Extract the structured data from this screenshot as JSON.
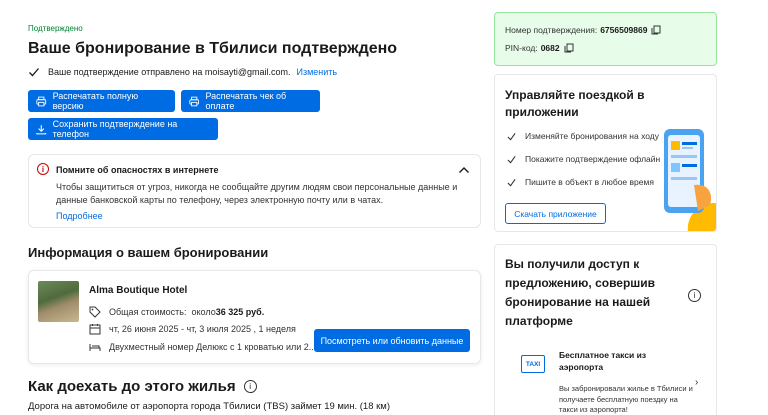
{
  "header": {
    "status": "Подтверждено",
    "title": "Ваше бронирование в Тбилиси подтверждено",
    "sent_text": "Ваше подтверждение отправлено на moisayti@gmail.com.",
    "change_link": "Изменить"
  },
  "actions": {
    "print_full": "Распечатать полную версию",
    "print_receipt": "Распечатать чек об оплате",
    "save_phone": "Сохранить подтверждение на телефон"
  },
  "alert": {
    "title": "Помните об опасностях в интернете",
    "body": "Чтобы защититься от угроз, никогда не сообщайте другим людям свои персональные данные и данные банковской карты по телефону, через электронную почту или в чатах.",
    "more": "Подробнее"
  },
  "booking": {
    "section_title": "Информация о вашем бронировании",
    "hotel_name": "Alma Boutique Hotel",
    "cost_label": "Общая стоимость:",
    "cost_prefix": "около",
    "cost_value": "36 325 руб.",
    "dates": "чт, 26 июня 2025 - чт, 3 июля 2025 , 1 неделя",
    "room": "Двухместный номер Делюкс с 1 кроватью или 2...",
    "view_button": "Посмотреть или обновить данные"
  },
  "directions": {
    "title": "Как доехать до этого жилья",
    "subtitle": "Дорога на автомобиле от аэропорта города Тбилиси (TBS) займет 19 мин. (18 км)"
  },
  "confirmation": {
    "number_label": "Номер подтверждения:",
    "number_value": "6756509869",
    "pin_label": "PIN-код:",
    "pin_value": "0682"
  },
  "manage": {
    "title": "Управляйте поездкой в приложении",
    "items": [
      "Изменяйте бронирования на ходу",
      "Покажите подтверждение офлайн",
      "Пишите в объект в любое время"
    ],
    "button": "Скачать приложение"
  },
  "offer": {
    "title": "Вы получили доступ к предложению, совершив бронирование на нашей платформе",
    "taxi_icon_label": "TAXI",
    "taxi_title": "Бесплатное такси из аэропорта",
    "taxi_body": "Вы забронировали жилье в Тбилиси и получаете бесплатную поездку на такси из аэропорта!"
  },
  "colors": {
    "accent": "#006ce4",
    "success": "#008234",
    "confirm_bg": "#e7fde9",
    "warning": "#cc0000"
  }
}
